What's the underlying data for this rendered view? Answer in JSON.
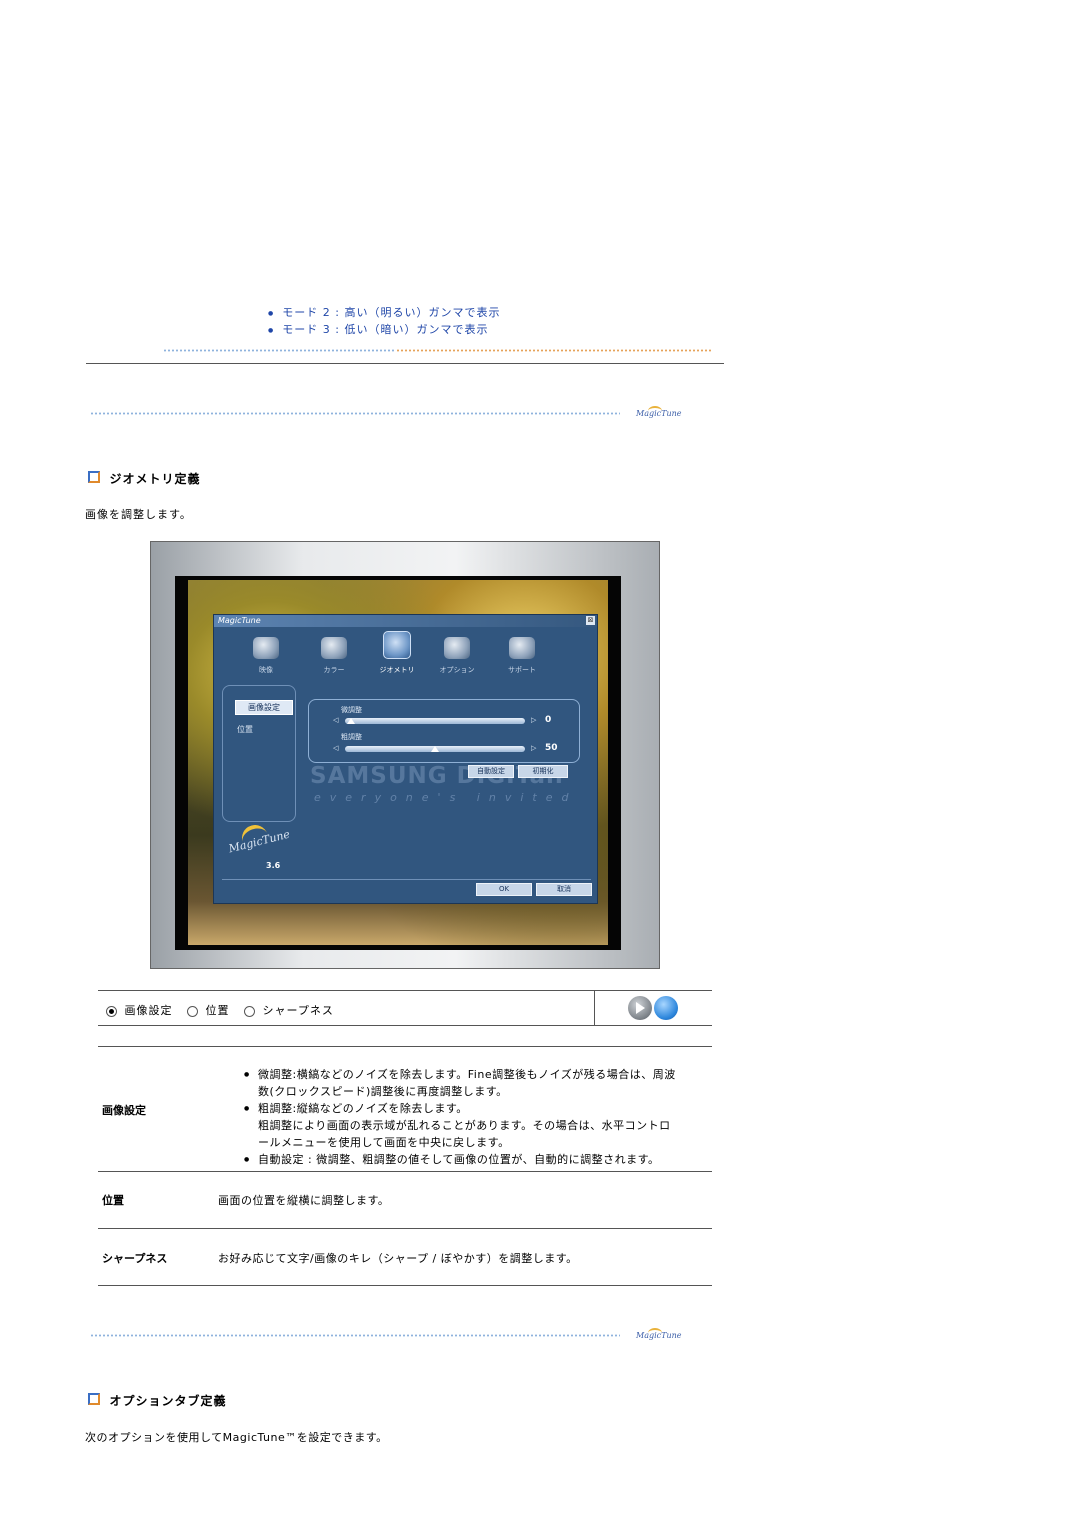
{
  "modes": [
    "モード 2 : 高い（明るい）ガンマで表示",
    "モード 3 : 低い（暗い）ガンマで表示"
  ],
  "logo_text": "MagicTune",
  "geometry": {
    "title": "ジオメトリ定義",
    "intro": "画像を調整します。"
  },
  "screenshot": {
    "window_title": "MagicTune",
    "close": "⊠",
    "tabs": [
      "映像",
      "カラー",
      "ジオメトリ",
      "オプション",
      "サポート"
    ],
    "side": {
      "selected": "画像設定",
      "other": "位置"
    },
    "fine_label": "微調整",
    "fine_value": "0",
    "fine_level": 0.0,
    "coarse_label": "粗調整",
    "coarse_value": "50",
    "coarse_level": 0.5,
    "auto_button": "自動設定",
    "reset_button": "初期化",
    "brand": "SAMSUNG DIGITall",
    "tagline": "everyone's invited",
    "version_logo": "MagicTune",
    "version": "3.6",
    "ok_button": "OK",
    "cancel_button": "取消"
  },
  "tab_strip": {
    "options": [
      "画像設定",
      "位置",
      "シャープネス"
    ],
    "selected": "画像設定"
  },
  "table": {
    "row1": {
      "label": "画像設定",
      "items": [
        "微調整:横縞などのノイズを除去します。Fine調整後もノイズが残る場合は、周波",
        "数(クロックスピード)調整後に再度調整します。",
        "粗調整:縦縞などのノイズを除去します。",
        "粗調整により画面の表示域が乱れることがあります。その場合は、水平コントロ",
        "ールメニューを使用して画面を中央に戻します。",
        "自動設定 : 微調整、粗調整の値そして画像の位置が、自動的に調整されます。"
      ]
    },
    "row2": {
      "label": "位置",
      "text": "画面の位置を縦横に調整します。"
    },
    "row3": {
      "label": "シャープネス",
      "text": "お好み応じて文字/画像のキレ（シャープ / ぼやかす）を調整します。"
    }
  },
  "options_section": {
    "title": "オプションタブ定義",
    "intro": "次のオプションを使用してMagicTune™を設定できます。"
  }
}
